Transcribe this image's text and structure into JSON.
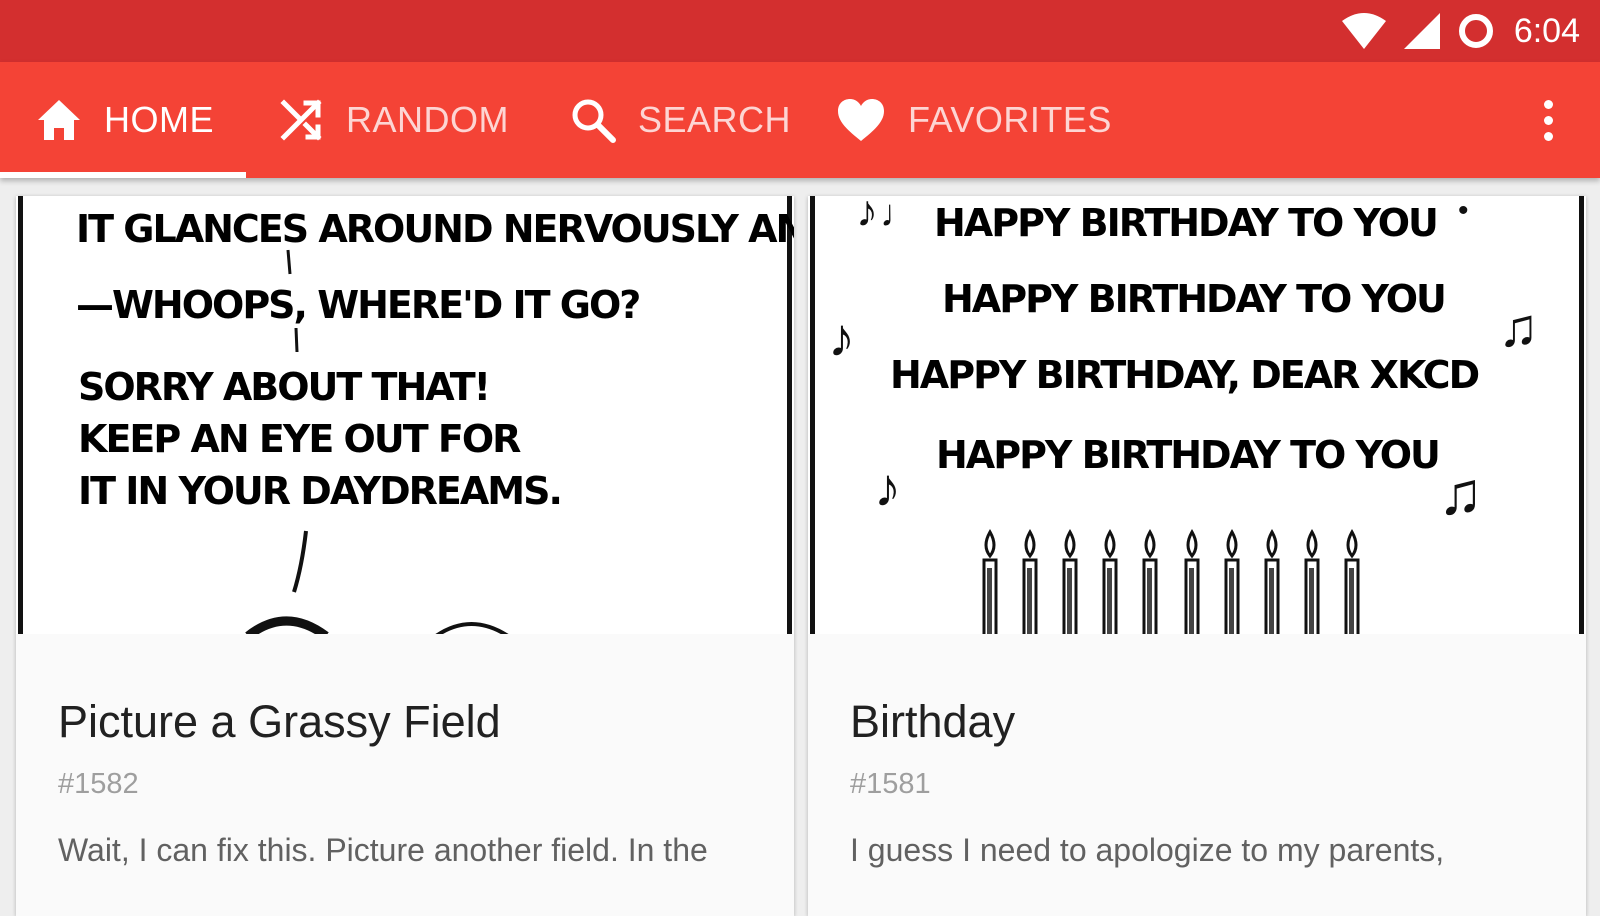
{
  "status_bar": {
    "time": "6:04",
    "icons": [
      "wifi-icon",
      "cell-signal-icon",
      "sync-icon"
    ]
  },
  "tabs": [
    {
      "label": "HOME",
      "icon": "home-icon",
      "active": true
    },
    {
      "label": "RANDOM",
      "icon": "shuffle-icon",
      "active": false
    },
    {
      "label": "SEARCH",
      "icon": "search-icon",
      "active": false
    },
    {
      "label": "FAVORITES",
      "icon": "heart-icon",
      "active": false
    }
  ],
  "colors": {
    "status_bar": "#d32f2f",
    "app_bar": "#f44336",
    "card_bg": "#fafafa"
  },
  "cards": [
    {
      "title": "Picture a Grassy Field",
      "number": "#1582",
      "description": "Wait, I can fix this. Picture another field. In the",
      "comic_text": {
        "line1": "IT GLANCES AROUND NERVOUSLY AND–",
        "line2": "—WHOOPS, WHERE'D IT GO?",
        "line3": "SORRY ABOUT THAT!",
        "line4": "KEEP AN EYE OUT FOR",
        "line5": "IT IN YOUR DAYDREAMS."
      }
    },
    {
      "title": "Birthday",
      "number": "#1581",
      "description": "I guess I need to apologize to my parents,",
      "comic_text": {
        "line1": "HAPPY BIRTHDAY TO YOU",
        "line2": "HAPPY BIRTHDAY TO YOU",
        "line3": "HAPPY BIRTHDAY, DEAR XKCD",
        "line4": "HAPPY BIRTHDAY TO YOU"
      }
    }
  ]
}
